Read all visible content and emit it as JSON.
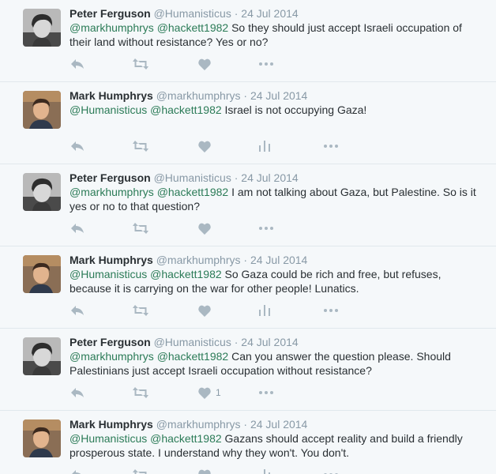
{
  "users": {
    "peter": {
      "name": "Peter Ferguson",
      "handle": "@Humanisticus",
      "avatar": "peter"
    },
    "mark": {
      "name": "Mark Humphrys",
      "handle": "@markhumphrys",
      "avatar": "mark"
    }
  },
  "separator": "·",
  "tweets": [
    {
      "name": "Peter Ferguson",
      "handle": "@Humanisticus",
      "time": "24 Jul 2014",
      "avatar": "peter",
      "mentions": [
        "@markhumphrys",
        "@hackett1982"
      ],
      "text": "So they should just accept Israeli occupation of their land without resistance? Yes or no?",
      "stats": false,
      "fav_count": ""
    },
    {
      "name": "Mark Humphrys",
      "handle": "@markhumphrys",
      "time": "24 Jul 2014",
      "avatar": "mark",
      "mentions": [
        "@Humanisticus",
        "@hackett1982"
      ],
      "text": "Israel is not occupying Gaza!",
      "stats": true,
      "fav_count": ""
    },
    {
      "name": "Peter Ferguson",
      "handle": "@Humanisticus",
      "time": "24 Jul 2014",
      "avatar": "peter",
      "mentions": [
        "@markhumphrys",
        "@hackett1982"
      ],
      "text": "I am not talking about Gaza, but Palestine. So is it yes or no to that question?",
      "stats": false,
      "fav_count": ""
    },
    {
      "name": "Mark Humphrys",
      "handle": "@markhumphrys",
      "time": "24 Jul 2014",
      "avatar": "mark",
      "mentions": [
        "@Humanisticus",
        "@hackett1982"
      ],
      "text": "So Gaza could be rich and free, but refuses, because it is carrying on the war for other people! Lunatics.",
      "stats": true,
      "fav_count": ""
    },
    {
      "name": "Peter Ferguson",
      "handle": "@Humanisticus",
      "time": "24 Jul 2014",
      "avatar": "peter",
      "mentions": [
        "@markhumphrys",
        "@hackett1982"
      ],
      "text": "Can you answer the question please. Should Palestinians just accept Israeli occupation without resistance?",
      "stats": false,
      "fav_count": "1"
    },
    {
      "name": "Mark Humphrys",
      "handle": "@markhumphrys",
      "time": "24 Jul 2014",
      "avatar": "mark",
      "mentions": [
        "@Humanisticus",
        "@hackett1982"
      ],
      "text": "Gazans should accept reality and build a friendly prosperous state. I understand why they won't. You don't.",
      "stats": true,
      "fav_count": ""
    }
  ],
  "icons": {
    "reply": "reply-icon",
    "retweet": "retweet-icon",
    "favorite": "heart-icon",
    "stats": "stats-icon",
    "more": "more-icon"
  },
  "colors": {
    "mention": "#2b7b57",
    "meta": "#8899a6",
    "icon": "#aab8c2",
    "background": "#f5f8fa",
    "divider": "#e1e8ed"
  }
}
